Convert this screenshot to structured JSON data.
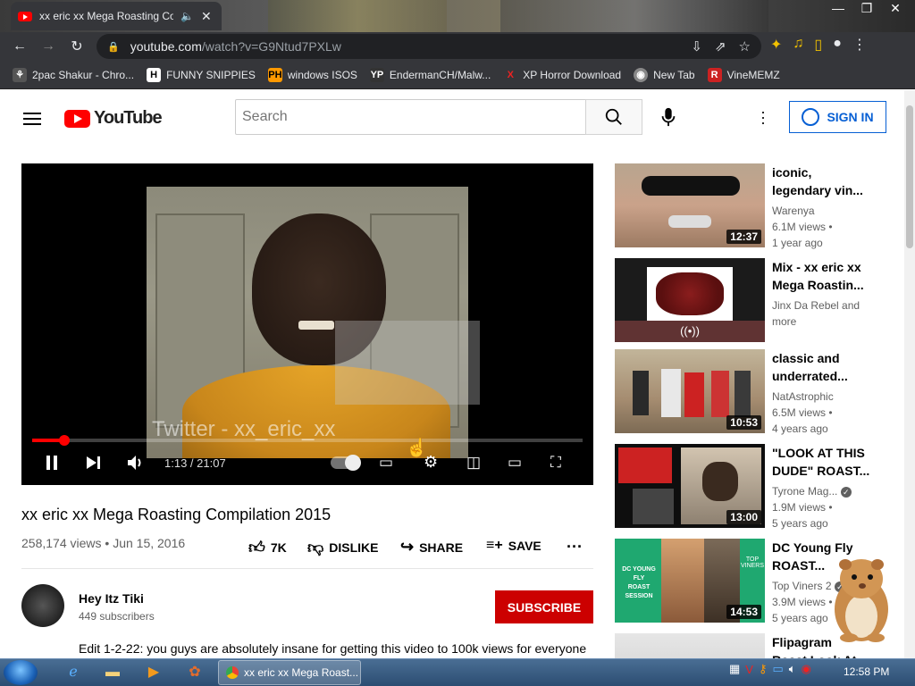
{
  "browser": {
    "tab_title": "xx eric xx Mega Roasting Co",
    "url_host": "youtube.com",
    "url_path": "/watch?v=G9Ntud7PXLw",
    "bookmarks": [
      {
        "label": "2pac Shakur - Chro...",
        "icon": "2pac-icon"
      },
      {
        "label": "FUNNY SNIPPIES",
        "icon": "h-icon"
      },
      {
        "label": "windows ISOS",
        "icon": "ph-icon"
      },
      {
        "label": "EndermanCH/Malw...",
        "icon": "yp-icon"
      },
      {
        "label": "XP Horror Download",
        "icon": "x-icon"
      },
      {
        "label": "New Tab",
        "icon": "globe-icon"
      },
      {
        "label": "VineMEMZ",
        "icon": "r-icon"
      }
    ]
  },
  "header": {
    "logo": "YouTube",
    "search_placeholder": "Search",
    "signin": "SIGN IN"
  },
  "player": {
    "time": "1:13 / 21:07",
    "watermark": "Twitter - xx_eric_xx",
    "progress": 0.058
  },
  "video": {
    "title": "xx eric xx Mega Roasting Compilation 2015",
    "views": "258,174 views",
    "date": "Jun 15, 2016",
    "likes": "7K",
    "dislike": "DISLIKE",
    "share": "SHARE",
    "save": "SAVE",
    "channel": "Hey Itz Tiki",
    "subscribers": "449 subscribers",
    "subscribe": "SUBSCRIBE",
    "description": "Edit 1-2-22: you guys are absolutely insane for getting this video to 100k views for everyone"
  },
  "related": [
    {
      "title": "iconic, legendary vin...",
      "channel": "Warenya",
      "views": "6.1M views •",
      "age": "1 year ago",
      "duration": "12:37"
    },
    {
      "title": "Mix - xx eric xx Mega Roastin...",
      "channel": "Jinx Da Rebel and more",
      "views": "",
      "age": "",
      "duration": ""
    },
    {
      "title": "classic and underrated...",
      "channel": "NatAstrophic",
      "views": "6.5M views •",
      "age": "4 years ago",
      "duration": "10:53"
    },
    {
      "title": "\"LOOK AT THIS DUDE\" ROAST...",
      "channel": "Tyrone Mag...",
      "views": "1.9M views •",
      "age": "5 years ago",
      "duration": "13:00"
    },
    {
      "title": "DC Young Fly ROAST...",
      "channel": "Top Viners 2",
      "views": "3.9M views •",
      "age": "5 years ago",
      "duration": "14:53"
    },
    {
      "title": "Flipagram Roast Look At",
      "channel": "",
      "views": "",
      "age": "",
      "duration": ""
    }
  ],
  "taskbar": {
    "task_label": "xx eric xx Mega Roast...",
    "clock": "12:58 PM"
  }
}
